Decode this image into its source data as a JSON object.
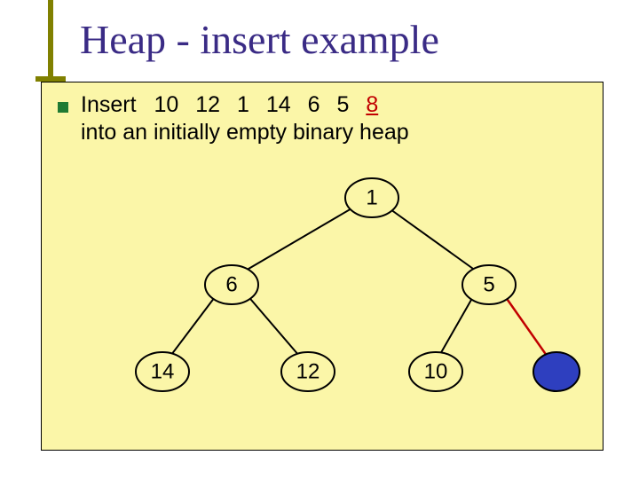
{
  "title": "Heap - insert example",
  "bullet": {
    "prefix": "Insert",
    "sequence": [
      "10",
      "12",
      "1",
      "14",
      "6",
      "5",
      "8"
    ],
    "current_index": 6,
    "tail": "into an initially empty binary heap"
  },
  "tree": {
    "nodes": {
      "root": {
        "label": "1"
      },
      "l": {
        "label": "6"
      },
      "r": {
        "label": "5"
      },
      "ll": {
        "label": "14"
      },
      "lr": {
        "label": "12"
      },
      "rl": {
        "label": "10"
      },
      "rr": {
        "label": "",
        "filled": true
      }
    }
  }
}
